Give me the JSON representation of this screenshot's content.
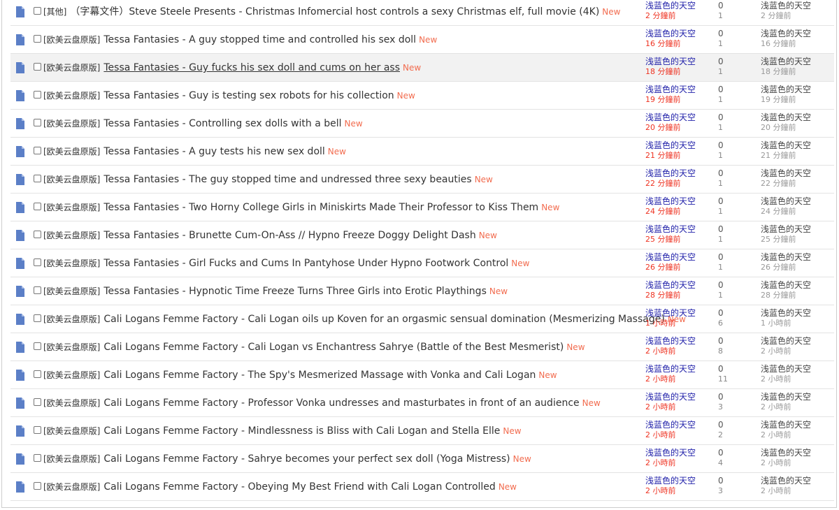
{
  "colors": {
    "accent_new": "#f26c4f",
    "author": "#2222aa",
    "time_recent": "#ee3322",
    "icon": "#5b7fc7"
  },
  "icons": {
    "thread": "document-icon",
    "select": "checkbox"
  },
  "threads": [
    {
      "tag": "[其他]",
      "title": "（字幕文件）Steve Steele Presents - Christmas Infomercial host controls a sexy Christmas elf, full movie (4K)",
      "new": "New",
      "author": "浅蓝色的天空",
      "time": "2 分鐘前",
      "replies": "0",
      "views": "1",
      "last_author": "浅蓝色的天空",
      "last_time": "2 分鐘前"
    },
    {
      "tag": "[欧美云盘原版]",
      "title": "Tessa Fantasies - A guy stopped time and controlled his sex doll",
      "new": "New",
      "author": "浅蓝色的天空",
      "time": "16 分鐘前",
      "replies": "0",
      "views": "1",
      "last_author": "浅蓝色的天空",
      "last_time": "16 分鐘前"
    },
    {
      "tag": "[欧美云盘原版]",
      "title": "Tessa Fantasies - Guy fucks his sex doll and cums on her ass",
      "new": "New",
      "author": "浅蓝色的天空",
      "time": "18 分鐘前",
      "replies": "0",
      "views": "1",
      "last_author": "浅蓝色的天空",
      "last_time": "18 分鐘前"
    },
    {
      "tag": "[欧美云盘原版]",
      "title": "Tessa Fantasies - Guy is testing sex robots for his collection",
      "new": "New",
      "author": "浅蓝色的天空",
      "time": "19 分鐘前",
      "replies": "0",
      "views": "1",
      "last_author": "浅蓝色的天空",
      "last_time": "19 分鐘前"
    },
    {
      "tag": "[欧美云盘原版]",
      "title": "Tessa Fantasies - Controlling sex dolls with a bell",
      "new": "New",
      "author": "浅蓝色的天空",
      "time": "20 分鐘前",
      "replies": "0",
      "views": "1",
      "last_author": "浅蓝色的天空",
      "last_time": "20 分鐘前"
    },
    {
      "tag": "[欧美云盘原版]",
      "title": "Tessa Fantasies - A guy tests his new sex doll",
      "new": "New",
      "author": "浅蓝色的天空",
      "time": "21 分鐘前",
      "replies": "0",
      "views": "1",
      "last_author": "浅蓝色的天空",
      "last_time": "21 分鐘前"
    },
    {
      "tag": "[欧美云盘原版]",
      "title": "Tessa Fantasies - The guy stopped time and undressed three sexy beauties",
      "new": "New",
      "author": "浅蓝色的天空",
      "time": "22 分鐘前",
      "replies": "0",
      "views": "1",
      "last_author": "浅蓝色的天空",
      "last_time": "22 分鐘前"
    },
    {
      "tag": "[欧美云盘原版]",
      "title": "Tessa Fantasies - Two Horny College Girls in Miniskirts Made Their Professor to Kiss Them",
      "new": "New",
      "author": "浅蓝色的天空",
      "time": "24 分鐘前",
      "replies": "0",
      "views": "1",
      "last_author": "浅蓝色的天空",
      "last_time": "24 分鐘前"
    },
    {
      "tag": "[欧美云盘原版]",
      "title": "Tessa Fantasies - Brunette Cum-On-Ass // Hypno Freeze Doggy Delight Dash",
      "new": "New",
      "author": "浅蓝色的天空",
      "time": "25 分鐘前",
      "replies": "0",
      "views": "1",
      "last_author": "浅蓝色的天空",
      "last_time": "25 分鐘前"
    },
    {
      "tag": "[欧美云盘原版]",
      "title": "Tessa Fantasies - Girl Fucks and Cums In Pantyhose Under Hypno Footwork Control",
      "new": "New",
      "author": "浅蓝色的天空",
      "time": "26 分鐘前",
      "replies": "0",
      "views": "1",
      "last_author": "浅蓝色的天空",
      "last_time": "26 分鐘前"
    },
    {
      "tag": "[欧美云盘原版]",
      "title": "Tessa Fantasies - Hypnotic Time Freeze Turns Three Girls into Erotic Playthings",
      "new": "New",
      "author": "浅蓝色的天空",
      "time": "28 分鐘前",
      "replies": "0",
      "views": "1",
      "last_author": "浅蓝色的天空",
      "last_time": "28 分鐘前"
    },
    {
      "tag": "[欧美云盘原版]",
      "title": "Cali Logans Femme Factory - Cali Logan oils up Koven for an orgasmic sensual domination (Mesmerizing Massage)",
      "new": "New",
      "author": "浅蓝色的天空",
      "time": "1 小時前",
      "replies": "0",
      "views": "6",
      "last_author": "浅蓝色的天空",
      "last_time": "1 小時前"
    },
    {
      "tag": "[欧美云盘原版]",
      "title": "Cali Logans Femme Factory - Cali Logan vs Enchantress Sahrye (Battle of the Best Mesmerist)",
      "new": "New",
      "author": "浅蓝色的天空",
      "time": "2 小時前",
      "replies": "0",
      "views": "8",
      "last_author": "浅蓝色的天空",
      "last_time": "2 小時前"
    },
    {
      "tag": "[欧美云盘原版]",
      "title": "Cali Logans Femme Factory - The Spy's Mesmerized Massage with Vonka and Cali Logan",
      "new": "New",
      "author": "浅蓝色的天空",
      "time": "2 小時前",
      "replies": "0",
      "views": "11",
      "last_author": "浅蓝色的天空",
      "last_time": "2 小時前"
    },
    {
      "tag": "[欧美云盘原版]",
      "title": "Cali Logans Femme Factory - Professor Vonka undresses and masturbates in front of an audience",
      "new": "New",
      "author": "浅蓝色的天空",
      "time": "2 小時前",
      "replies": "0",
      "views": "3",
      "last_author": "浅蓝色的天空",
      "last_time": "2 小時前"
    },
    {
      "tag": "[欧美云盘原版]",
      "title": "Cali Logans Femme Factory - Mindlessness is Bliss with Cali Logan and Stella Elle",
      "new": "New",
      "author": "浅蓝色的天空",
      "time": "2 小時前",
      "replies": "0",
      "views": "2",
      "last_author": "浅蓝色的天空",
      "last_time": "2 小時前"
    },
    {
      "tag": "[欧美云盘原版]",
      "title": "Cali Logans Femme Factory - Sahrye becomes your perfect sex doll (Yoga Mistress)",
      "new": "New",
      "author": "浅蓝色的天空",
      "time": "2 小時前",
      "replies": "0",
      "views": "4",
      "last_author": "浅蓝色的天空",
      "last_time": "2 小時前"
    },
    {
      "tag": "[欧美云盘原版]",
      "title": "Cali Logans Femme Factory - Obeying My Best Friend with Cali Logan Controlled",
      "new": "New",
      "author": "浅蓝色的天空",
      "time": "2 小時前",
      "replies": "0",
      "views": "3",
      "last_author": "浅蓝色的天空",
      "last_time": "2 小時前"
    }
  ]
}
